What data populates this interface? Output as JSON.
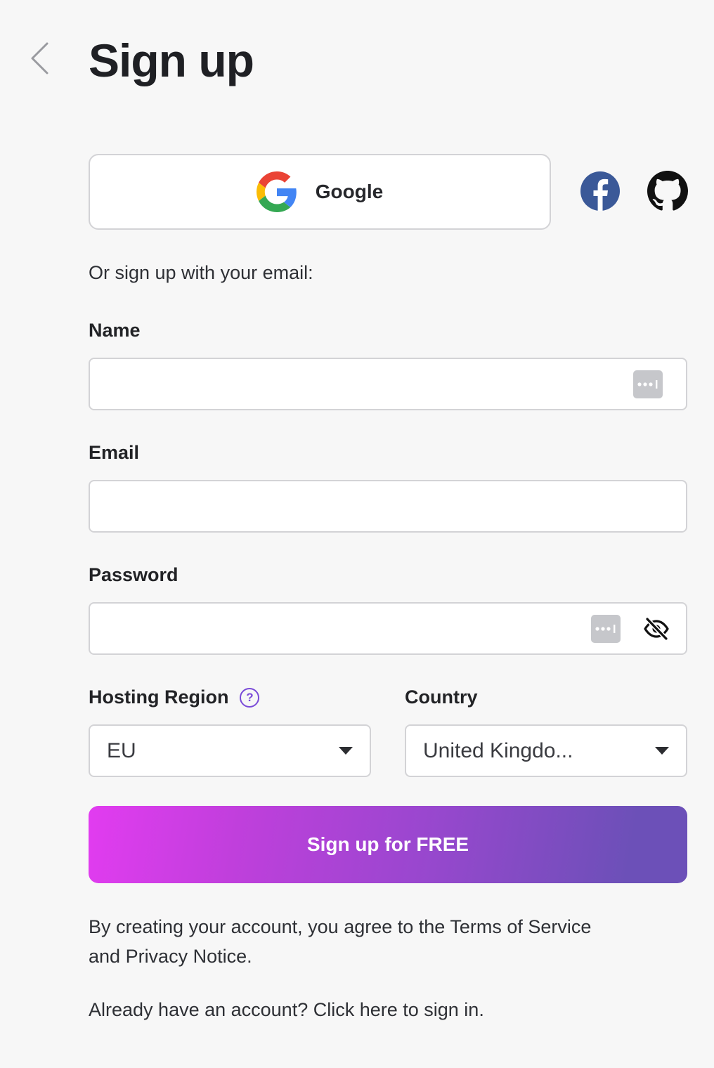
{
  "header": {
    "title": "Sign up"
  },
  "social": {
    "google_label": "Google"
  },
  "or_text": "Or sign up with your email:",
  "form": {
    "name_label": "Name",
    "name_value": "",
    "email_label": "Email",
    "email_value": "",
    "password_label": "Password",
    "password_value": "",
    "hosting_region_label": "Hosting Region",
    "hosting_region_value": "EU",
    "help_glyph": "?",
    "country_label": "Country",
    "country_value": "United Kingdo..."
  },
  "cta": {
    "label": "Sign up for FREE"
  },
  "footer": {
    "terms_prefix": "By creating your account, you agree to the ",
    "terms_link": "Terms of Service",
    "terms_and": " and ",
    "privacy_link": "Privacy Notice",
    "terms_suffix": ".",
    "signin_prefix": "Already have an account? ",
    "signin_link": "Click here to sign in."
  },
  "colors": {
    "background": "#f7f7f7",
    "facebook": "#3b5998",
    "accent": "#7a4bd8",
    "cta_gradient_start": "#e23cf0",
    "cta_gradient_end": "#6c50b8"
  },
  "icons": [
    "back-chevron-icon",
    "google-icon",
    "facebook-icon",
    "github-icon",
    "password-manager-icon",
    "eye-slash-icon",
    "help-icon",
    "dropdown-caret-icon"
  ]
}
